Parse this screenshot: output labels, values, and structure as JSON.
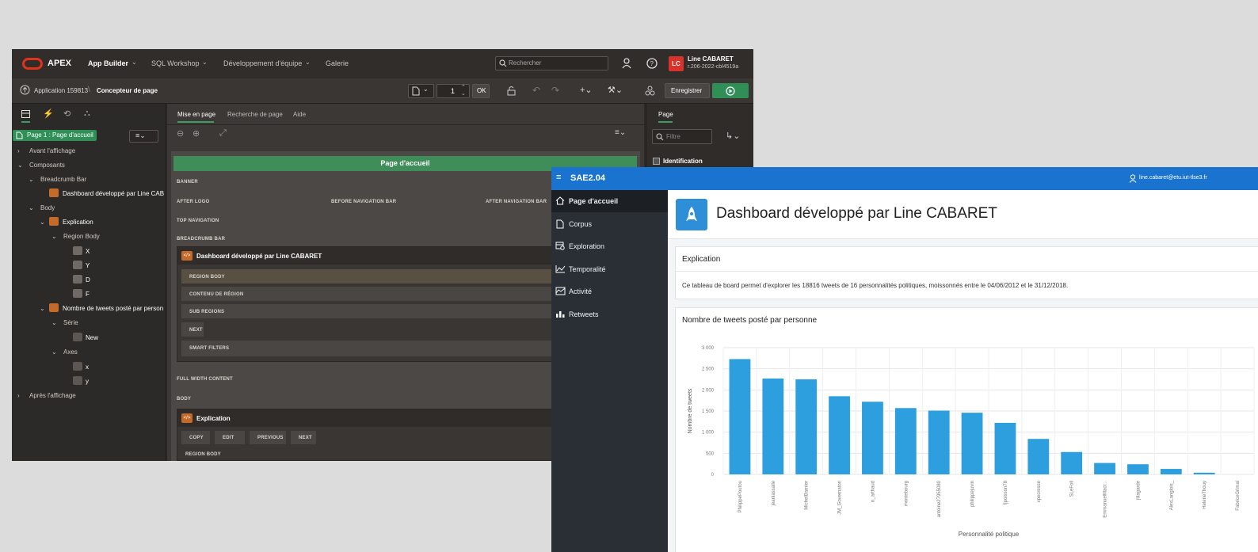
{
  "apex": {
    "logo_text": "APEX",
    "menu": [
      "App Builder",
      "SQL Workshop",
      "Développement d'équipe",
      "Galerie"
    ],
    "search_placeholder": "Rechercher",
    "user_initials": "LC",
    "user_name": "Line CABARET",
    "user_workspace": "r.206-2022-cbl4519a",
    "breadcrumb_app": "Application 159813",
    "breadcrumb_page": "Concepteur de page",
    "page_number": "1",
    "ok_label": "OK",
    "save_label": "Enregistrer",
    "left_tree": {
      "selected": "Page 1 : Page d'accueil",
      "items": [
        "Avant l'affichage",
        "Composants",
        "Breadcrumb Bar",
        "Dashboard développé par Line CAB",
        "Body",
        "Explication",
        "Region Body",
        "X",
        "Y",
        "D",
        "F",
        "Nombre de tweets posté par person",
        "Série",
        "New",
        "Axes",
        "x",
        "y",
        "Après l'affichage"
      ]
    },
    "center_tabs": [
      "Mise en page",
      "Recherche de page",
      "Aide"
    ],
    "canvas": {
      "page_title": "Page d'accueil",
      "banner": "BANNER",
      "after_logo": "AFTER LOGO",
      "before_nav": "BEFORE NAVIGATION BAR",
      "after_nav": "AFTER NAVIGATION BAR",
      "top_nav": "TOP NAVIGATION",
      "breadcrumb_bar": "BREADCRUMB BAR",
      "region1_title": "Dashboard développé par Line CABARET",
      "region1_slots": [
        "REGION BODY",
        "CONTENU DE RÉGION",
        "SUB REGIONS",
        "NEXT",
        "SMART FILTERS"
      ],
      "full_width": "FULL WIDTH CONTENT",
      "body": "BODY",
      "region2_title": "Explication",
      "region2_buttons": [
        "COPY",
        "EDIT",
        "PREVIOUS",
        "NEXT"
      ],
      "region2_body": "REGION BODY"
    },
    "right_panel": {
      "tab": "Page",
      "filter_placeholder": "Filtre",
      "section": "Identification"
    }
  },
  "sae": {
    "app_title": "SAE2.04",
    "user_email": "line.cabaret@etu.iut-tlse3.fr",
    "nav": [
      "Page d'accueil",
      "Corpus",
      "Exploration",
      "Temporalité",
      "Activité",
      "Retweets"
    ],
    "page_title": "Dashboard développé par Line CABARET",
    "explication_title": "Explication",
    "explication_text": "Ce tableau de board permet d'explorer les 18816 tweets de 16 personnalités politiques, moissonnés entre le 04/06/2012 et le 31/12/2018.",
    "chart_card_title": "Nombre de tweets posté par personne"
  },
  "chart_data": {
    "type": "bar",
    "title": "",
    "xlabel": "Personnalité politique",
    "ylabel": "Nombre de tweets",
    "ylim": [
      0,
      3000
    ],
    "yticks": [
      "0",
      "500",
      "1 000",
      "1 500",
      "2 000",
      "2 500",
      "3 000"
    ],
    "grid": true,
    "categories": [
      "PhilippePoutou",
      "jeanlassalle",
      "MichelBarnier",
      "JM_Governatori",
      "n_arthaud",
      "montebourg",
      "antoine27955080",
      "philippejuvin",
      "fjpoisson78",
      "vpecresse",
      "SLeFoll",
      "EmmanuelMacr...",
      "jlilagarde",
      "AlexLanglois_",
      "HeleneThouy",
      "FabriceGrimal"
    ],
    "values": [
      2730,
      2270,
      2250,
      1850,
      1720,
      1570,
      1510,
      1460,
      1220,
      840,
      530,
      270,
      240,
      130,
      40,
      0
    ],
    "colors": {
      "bar": "#2d9fde",
      "grid": "#e6e6e6"
    }
  }
}
